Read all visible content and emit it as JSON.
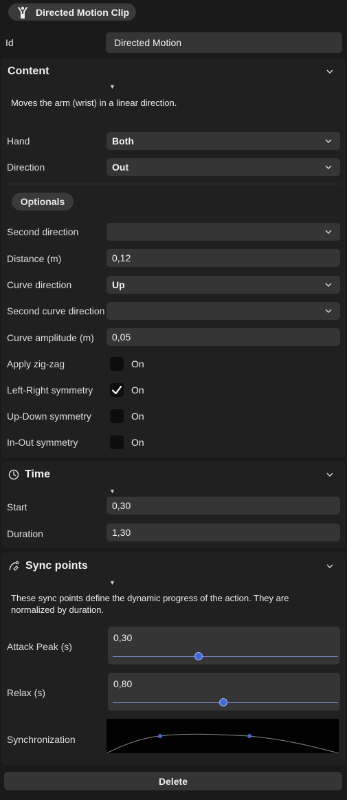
{
  "header": {
    "title": "Directed Motion Clip",
    "icon": "person-arms-raised-icon"
  },
  "id_row": {
    "label": "Id",
    "value": "Directed Motion"
  },
  "content": {
    "title": "Content",
    "description": "Moves the arm (wrist) in a linear direction.",
    "hand": {
      "label": "Hand",
      "value": "Both"
    },
    "direction": {
      "label": "Direction",
      "value": "Out"
    },
    "optionals_label": "Optionals",
    "second_direction": {
      "label": "Second direction",
      "value": ""
    },
    "distance": {
      "label": "Distance (m)",
      "value": "0,12"
    },
    "curve_direction": {
      "label": "Curve direction",
      "value": "Up"
    },
    "second_curve_direction": {
      "label": "Second curve direction",
      "value": ""
    },
    "curve_amplitude": {
      "label": "Curve amplitude (m)",
      "value": "0,05"
    },
    "checkboxes": [
      {
        "label": "Apply zig-zag",
        "text": "On",
        "checked": false
      },
      {
        "label": "Left-Right symmetry",
        "text": "On",
        "checked": true
      },
      {
        "label": "Up-Down symmetry",
        "text": "On",
        "checked": false
      },
      {
        "label": "In-Out symmetry",
        "text": "On",
        "checked": false
      }
    ]
  },
  "time": {
    "title": "Time",
    "icon": "clock-icon",
    "start": {
      "label": "Start",
      "value": "0,30"
    },
    "duration": {
      "label": "Duration",
      "value": "1,30"
    }
  },
  "sync": {
    "title": "Sync points",
    "icon": "curve-pen-icon",
    "description": "These sync points define the dynamic progress of the action. They are normalized by duration.",
    "attack_peak": {
      "label": "Attack Peak (s)",
      "value": "0,30",
      "fraction": 0.38
    },
    "relax": {
      "label": "Relax (s)",
      "value": "0,80",
      "fraction": 0.49
    },
    "synchronization_label": "Synchronization"
  },
  "delete_label": "Delete",
  "colors": {
    "accent": "#3f6ad8",
    "panel": "#202020",
    "field": "#353535"
  }
}
